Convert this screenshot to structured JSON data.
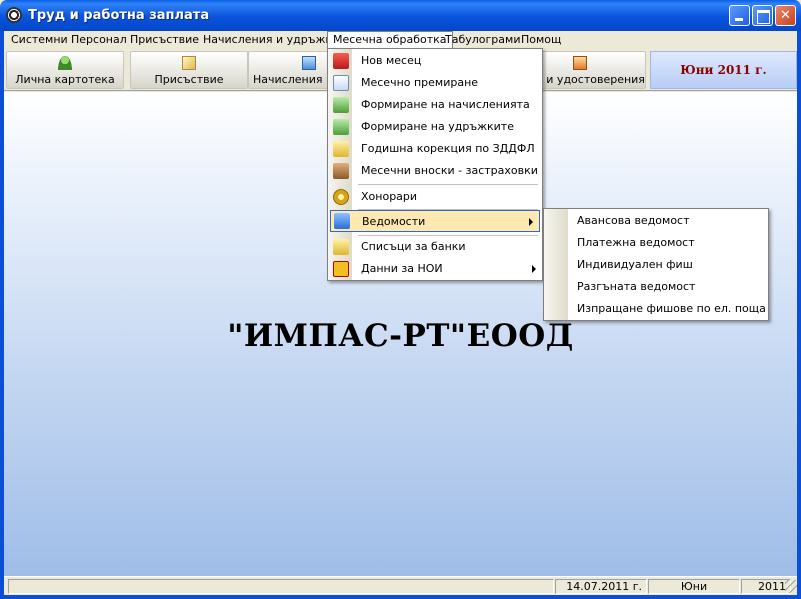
{
  "window": {
    "title": "Труд и работна заплата"
  },
  "menubar": {
    "items": [
      {
        "label": "Системни"
      },
      {
        "label": "Персонал"
      },
      {
        "label": "Присъствие"
      },
      {
        "label": "Начисления и удръжки"
      },
      {
        "label": "Месечна обработка",
        "active": true
      },
      {
        "label": "Табулограми"
      },
      {
        "label": "Помощ"
      }
    ]
  },
  "toolbar": {
    "buttons": [
      {
        "label": "Лична картотека",
        "icon": "person-icon"
      },
      {
        "label": "Присъствие",
        "icon": "pencil-note-icon"
      },
      {
        "label": "Начисления и у",
        "icon": "calculator-icon"
      },
      {
        "label": "ки и удостоверения",
        "icon": "certificate-icon"
      }
    ],
    "period": "Юни 2011 г."
  },
  "main": {
    "company_name": "\"ИМПАС-РТ\"ЕООД"
  },
  "month_menu": {
    "items": [
      {
        "label": "Нов месец",
        "icon": "calendar-icon"
      },
      {
        "label": "Месечно премиране",
        "icon": "doc-icon"
      },
      {
        "label": "Формиране на начисленията",
        "icon": "monitor-icon"
      },
      {
        "label": "Формиране на удръжките",
        "icon": "monitor-list-icon"
      },
      {
        "label": "Годишна корекция по ЗДДФЛ",
        "icon": "note-icon"
      },
      {
        "label": "Месечни вноски - застраховки",
        "icon": "package-icon"
      },
      {
        "label": "Хонорари",
        "icon": "coin-icon"
      },
      {
        "label": "Ведомости",
        "icon": "ledger-icon",
        "highlighted": true,
        "submenu": true
      },
      {
        "label": "Списъци за банки",
        "icon": "bank-icon"
      },
      {
        "label": "Данни за НОИ",
        "icon": "noi-icon",
        "submenu": true
      }
    ]
  },
  "payroll_submenu": {
    "items": [
      {
        "label": "Авансова ведомост"
      },
      {
        "label": "Платежна ведомост"
      },
      {
        "label": "Индивидуален фиш"
      },
      {
        "label": "Разгъната ведомост"
      },
      {
        "label": "Изпращане фишове по ел. поща"
      }
    ]
  },
  "statusbar": {
    "date": "14.07.2011 г.",
    "month": "Юни",
    "year": "2011"
  },
  "colors": {
    "title_bar": "#0a53dc",
    "period_text": "#8b0000",
    "menu_highlight": "#ffe9b0",
    "menu_highlight_border": "#316ac5"
  }
}
